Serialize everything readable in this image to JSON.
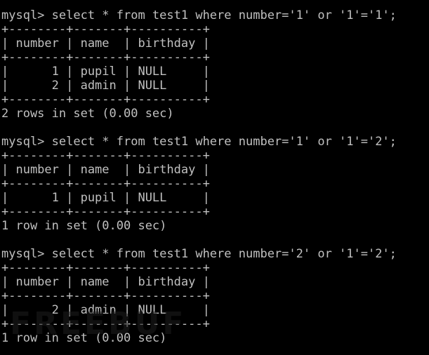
{
  "terminal": {
    "lines": [
      "mysql> select * from test1 where number='1' or '1'='1';",
      "+--------+-------+----------+",
      "| number | name  | birthday |",
      "+--------+-------+----------+",
      "|      1 | pupil | NULL     |",
      "|      2 | admin | NULL     |",
      "+--------+-------+----------+",
      "2 rows in set (0.00 sec)",
      "",
      "mysql> select * from test1 where number='1' or '1'='2';",
      "+--------+-------+----------+",
      "| number | name  | birthday |",
      "+--------+-------+----------+",
      "|      1 | pupil | NULL     |",
      "+--------+-------+----------+",
      "1 row in set (0.00 sec)",
      "",
      "mysql> select * from test1 where number='2' or '1'='2';",
      "+--------+-------+----------+",
      "| number | name  | birthday |",
      "+--------+-------+----------+",
      "|      2 | admin | NULL     |",
      "+--------+-------+----------+",
      "1 row in set (0.00 sec)"
    ]
  },
  "watermark": {
    "text": "FREEBUF"
  },
  "colors": {
    "background": "#000000",
    "text": "#c0c0c0"
  }
}
